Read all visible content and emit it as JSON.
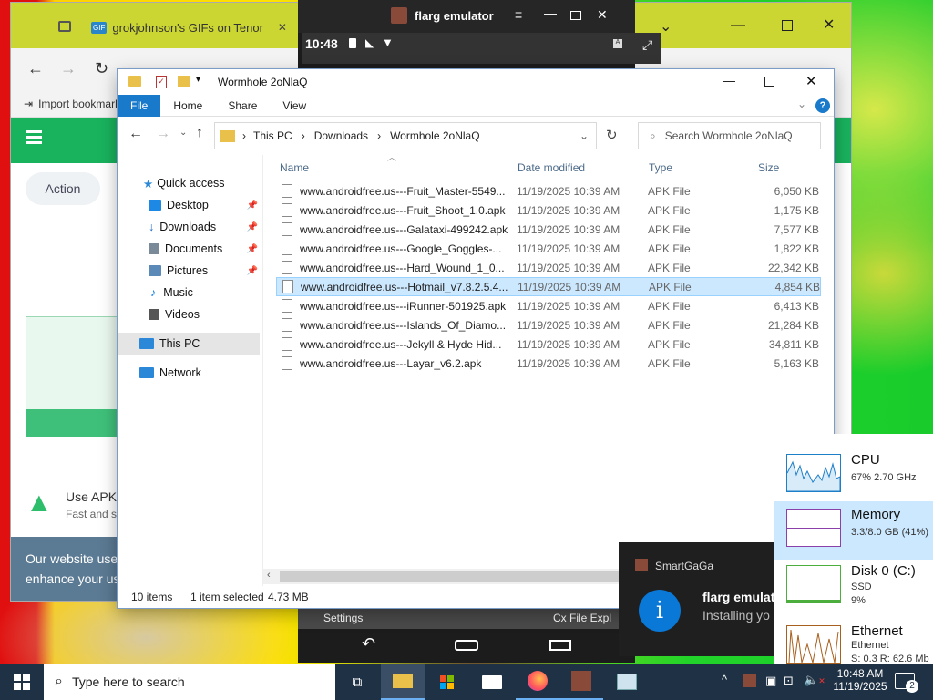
{
  "browser": {
    "tabs": [
      {
        "label": ""
      },
      {
        "label": "grokjohnson's GIFs on Tenor",
        "favicon": "GIF"
      }
    ],
    "bookmarks_label": "Import bookmarks...",
    "page": {
      "action_button": "Action",
      "promo_title": "Use APK",
      "promo_sub": "Fast and s",
      "cookie_text_line1": "Our website use",
      "cookie_text_line2": "enhance your us"
    }
  },
  "emulator": {
    "title": "flarg emulator",
    "time": "10:48",
    "bottom_left": "Settings",
    "bottom_right": "Cx File Expl"
  },
  "explorer": {
    "title": "Wormhole 2oNlaQ",
    "ribbon": [
      "File",
      "Home",
      "Share",
      "View"
    ],
    "breadcrumb": [
      "This PC",
      "Downloads",
      "Wormhole 2oNlaQ"
    ],
    "search_placeholder": "Search Wormhole 2oNlaQ",
    "columns": {
      "name": "Name",
      "date": "Date modified",
      "type": "Type",
      "size": "Size"
    },
    "nav": [
      {
        "label": "Quick access",
        "icon": "star-icon",
        "color": "#2b88d8",
        "pinned": false
      },
      {
        "label": "Desktop",
        "icon": "desktop-icon",
        "color": "#1e88e5",
        "pinned": true
      },
      {
        "label": "Downloads",
        "icon": "download-icon",
        "color": "#1565c0",
        "pinned": true
      },
      {
        "label": "Documents",
        "icon": "documents-icon",
        "color": "#7a8a99",
        "pinned": true
      },
      {
        "label": "Pictures",
        "icon": "pictures-icon",
        "color": "#5c8ab8",
        "pinned": true
      },
      {
        "label": "Music",
        "icon": "music-icon",
        "color": "#1e88e5",
        "pinned": false
      },
      {
        "label": "Videos",
        "icon": "videos-icon",
        "color": "#555555",
        "pinned": false
      },
      {
        "label": "This PC",
        "icon": "this-pc-icon",
        "color": "#2b88d8",
        "pinned": false
      },
      {
        "label": "Network",
        "icon": "network-icon",
        "color": "#2b88d8",
        "pinned": false
      }
    ],
    "files": [
      {
        "name": "www.androidfree.us---Fruit_Master-5549...",
        "date": "11/19/2025 10:39 AM",
        "type": "APK File",
        "size": "6,050 KB"
      },
      {
        "name": "www.androidfree.us---Fruit_Shoot_1.0.apk",
        "date": "11/19/2025 10:39 AM",
        "type": "APK File",
        "size": "1,175 KB"
      },
      {
        "name": "www.androidfree.us---Galataxi-499242.apk",
        "date": "11/19/2025 10:39 AM",
        "type": "APK File",
        "size": "7,577 KB"
      },
      {
        "name": "www.androidfree.us---Google_Goggles-...",
        "date": "11/19/2025 10:39 AM",
        "type": "APK File",
        "size": "1,822 KB"
      },
      {
        "name": "www.androidfree.us---Hard_Wound_1_0...",
        "date": "11/19/2025 10:39 AM",
        "type": "APK File",
        "size": "22,342 KB"
      },
      {
        "name": "www.androidfree.us---Hotmail_v7.8.2.5.4...",
        "date": "11/19/2025 10:39 AM",
        "type": "APK File",
        "size": "4,854 KB",
        "selected": true
      },
      {
        "name": "www.androidfree.us---iRunner-501925.apk",
        "date": "11/19/2025 10:39 AM",
        "type": "APK File",
        "size": "6,413 KB"
      },
      {
        "name": "www.androidfree.us---Islands_Of_Diamo...",
        "date": "11/19/2025 10:39 AM",
        "type": "APK File",
        "size": "21,284 KB"
      },
      {
        "name": "www.androidfree.us---Jekyll & Hyde Hid...",
        "date": "11/19/2025 10:39 AM",
        "type": "APK File",
        "size": "34,811 KB"
      },
      {
        "name": "www.androidfree.us---Layar_v6.2.apk",
        "date": "11/19/2025 10:39 AM",
        "type": "APK File",
        "size": "5,163 KB"
      }
    ],
    "status": {
      "items": "10 items",
      "selected": "1 item selected",
      "size": "4.73 MB"
    }
  },
  "toast": {
    "app": "SmartGaGa",
    "title": "flarg emulat",
    "body": "Installing yo"
  },
  "performance": [
    {
      "name": "CPU",
      "line1": "67%  2.70 GHz",
      "line2": "",
      "color": "#1e7fc9"
    },
    {
      "name": "Memory",
      "line1": "3.3/8.0 GB (41%)",
      "line2": "",
      "color": "#8b3fa8"
    },
    {
      "name": "Disk 0 (C:)",
      "line1": "SSD",
      "line2": "9%",
      "color": "#4caf3d"
    },
    {
      "name": "Ethernet",
      "line1": "Ethernet",
      "line2": "S: 0.3  R: 62.6 Mb",
      "color": "#a8601f"
    }
  ],
  "taskbar": {
    "search_placeholder": "Type here to search",
    "time": "10:48 AM",
    "date": "11/19/2025",
    "notifications": "2"
  }
}
